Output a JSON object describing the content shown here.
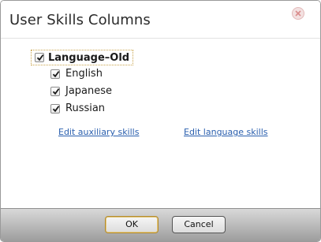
{
  "dialog": {
    "title": "User Skills Columns",
    "close_icon": "close-x-icon"
  },
  "tree": {
    "parent": {
      "label": "Language–Old",
      "checked": true
    },
    "children": [
      {
        "label": "English",
        "checked": true
      },
      {
        "label": "Japanese",
        "checked": true
      },
      {
        "label": "Russian",
        "checked": true
      }
    ]
  },
  "links": {
    "auxiliary": "Edit auxiliary skills",
    "language": "Edit language skills"
  },
  "footer": {
    "ok_label": "OK",
    "cancel_label": "Cancel"
  },
  "colors": {
    "link": "#2a5fae",
    "focus_outline": "#c9a34a",
    "footer_top": "#d9d9d9",
    "footer_bottom": "#9d9d9d"
  }
}
